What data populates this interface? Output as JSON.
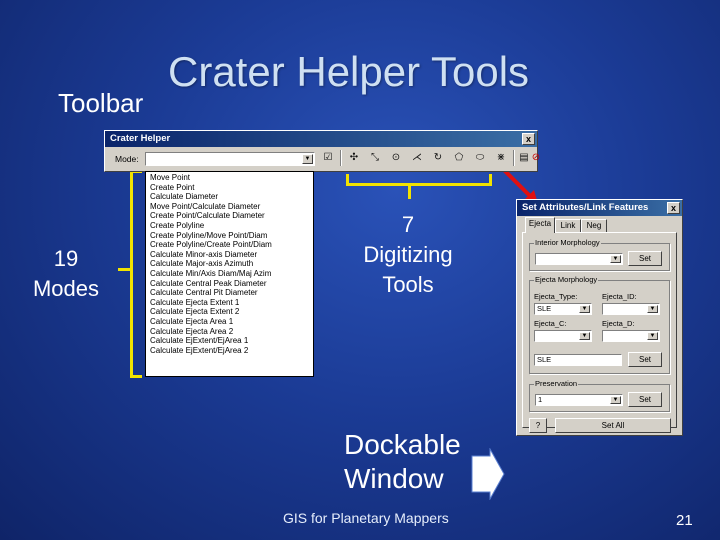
{
  "slide": {
    "title": "Crater Helper Tools",
    "toolbar_label": "Toolbar",
    "modes_callout": [
      "19",
      "Modes"
    ],
    "digitizing_callout": [
      "7",
      "Digitizing",
      "Tools"
    ],
    "dock_callout": [
      "Dockable",
      "Window"
    ],
    "footer": "GIS for Planetary Mappers",
    "page_number": "21"
  },
  "toolbar": {
    "window_title": "Crater Helper",
    "close_label": "x",
    "mode_label": "Mode:",
    "mode_value": "",
    "tools": [
      {
        "name": "checkbox-tool-icon",
        "glyph": "☑"
      },
      {
        "name": "move-point-tool-icon",
        "glyph": "✣"
      },
      {
        "name": "arrow-tool-icon",
        "glyph": "⤡"
      },
      {
        "name": "point-tool-icon",
        "glyph": "⊙"
      },
      {
        "name": "polyline-tool-icon",
        "glyph": "⋌"
      },
      {
        "name": "rotate-tool-icon",
        "glyph": "↻"
      },
      {
        "name": "polygon-tool-icon",
        "glyph": "⬠"
      },
      {
        "name": "ellipse-tool-icon",
        "glyph": "⬭"
      },
      {
        "name": "snap-tool-icon",
        "glyph": "⋇"
      },
      {
        "name": "attributes-tool-icon",
        "glyph": "▤"
      },
      {
        "name": "clear-tool-icon",
        "glyph": "⊘"
      }
    ]
  },
  "modes": [
    "Move Point",
    "Create Point",
    "Calculate Diameter",
    "Move Point/Calculate Diameter",
    "Create Point/Calculate Diameter",
    "Create Polyline",
    "Create Polyline/Move Point/Diam",
    "Create Polyline/Create Point/Diam",
    "Calculate Minor-axis Diameter",
    "Calculate Major-axis Azimuth",
    "Calculate Min/Axis Diam/Maj Azim",
    "Calculate Central Peak Diameter",
    "Calculate Central Pit Diameter",
    "Calculate Ejecta Extent 1",
    "Calculate Ejecta Extent 2",
    "Calculate Ejecta Area 1",
    "Calculate Ejecta Area 2",
    "Calculate EjExtent/EjArea 1",
    "Calculate EjExtent/EjArea 2"
  ],
  "dock": {
    "window_title": "Set Attributes/Link Features",
    "close_label": "x",
    "tabs": [
      "Ejecta",
      "Link",
      "Neg"
    ],
    "interior_group": "Interior Morphology",
    "set_label": "Set",
    "ejecta_group": "Ejecta Morphology",
    "ejecta_type_label": "Ejecta_Type:",
    "ejecta_id_label": "Ejecta_ID:",
    "ejecta_type_value": "SLE",
    "ejecta_id_value": "",
    "ejecta_c_label": "Ejecta_C:",
    "ejecta_d_label": "Ejecta_D:",
    "ejecta_combined_value": "SLE",
    "preservation_group": "Preservation",
    "preservation_value": "1",
    "help_label": "?",
    "set_all_label": "Set All"
  },
  "colors": {
    "bracket": "#f2e300",
    "arrow": "#e01010",
    "title": "#cfe0f2"
  }
}
